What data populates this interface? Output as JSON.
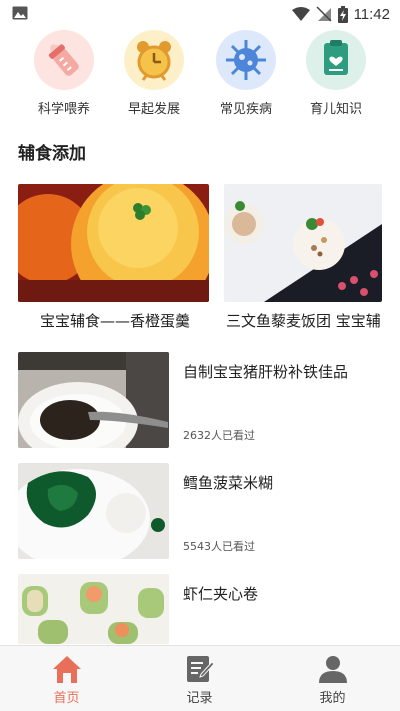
{
  "status_bar": {
    "time": "11:42"
  },
  "categories": [
    {
      "label": "科学喂养",
      "icon": "baby-bottle-icon",
      "bg": "#fde4e0"
    },
    {
      "label": "早起发展",
      "icon": "alarm-clock-icon",
      "bg": "#fdf0c8"
    },
    {
      "label": "常见疾病",
      "icon": "virus-icon",
      "bg": "#dde9fb"
    },
    {
      "label": "育儿知识",
      "icon": "clipboard-heart-icon",
      "bg": "#ddf1ea"
    }
  ],
  "section": {
    "title": "辅食添加"
  },
  "featured": [
    {
      "title": "宝宝辅食——香橙蛋羹"
    },
    {
      "title": "三文鱼藜麦饭团 宝宝辅"
    }
  ],
  "articles": [
    {
      "title": "自制宝宝猪肝粉补铁佳品",
      "views": "2632人已看过"
    },
    {
      "title": "鳕鱼菠菜米糊",
      "views": "5543人已看过"
    },
    {
      "title": "虾仁夹心卷",
      "views": ""
    }
  ],
  "nav": [
    {
      "label": "首页",
      "icon": "home-icon",
      "active": true
    },
    {
      "label": "记录",
      "icon": "edit-note-icon",
      "active": false
    },
    {
      "label": "我的",
      "icon": "person-icon",
      "active": false
    }
  ],
  "colors": {
    "accent": "#e8705a",
    "nav_icon": "#666666"
  }
}
